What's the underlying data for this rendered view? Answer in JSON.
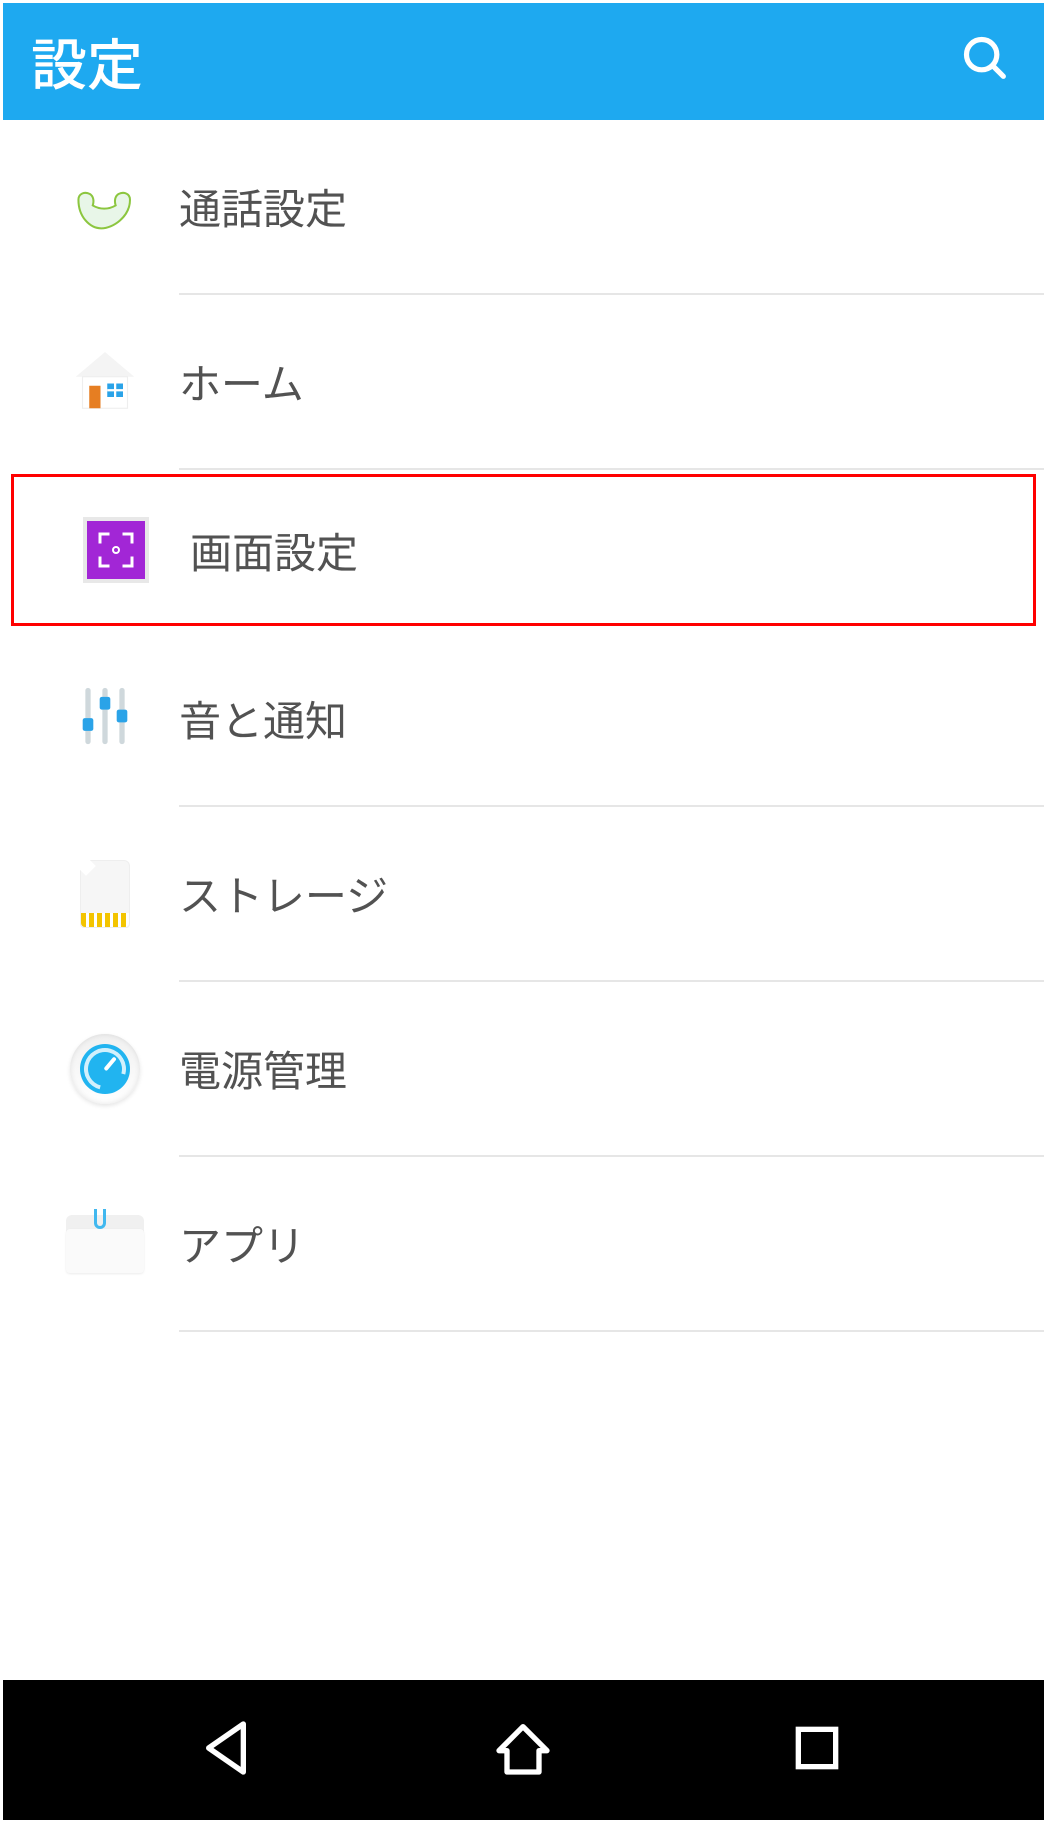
{
  "appbar": {
    "title": "設定",
    "search_icon": "search-icon"
  },
  "settings": {
    "items": [
      {
        "id": "call-settings",
        "label": "通話設定",
        "icon": "phone-icon",
        "highlighted": false
      },
      {
        "id": "home",
        "label": "ホーム",
        "icon": "home-icon",
        "highlighted": false
      },
      {
        "id": "display-settings",
        "label": "画面設定",
        "icon": "display-icon",
        "highlighted": true
      },
      {
        "id": "sound-notif",
        "label": "音と通知",
        "icon": "sliders-icon",
        "highlighted": false
      },
      {
        "id": "storage",
        "label": "ストレージ",
        "icon": "sdcard-icon",
        "highlighted": false
      },
      {
        "id": "power",
        "label": "電源管理",
        "icon": "gauge-icon",
        "highlighted": false
      },
      {
        "id": "apps",
        "label": "アプリ",
        "icon": "folder-icon",
        "highlighted": false
      }
    ]
  },
  "navbar": {
    "back": "back-icon",
    "home": "home-nav-icon",
    "recent": "recent-icon"
  },
  "colors": {
    "accent": "#1ea9f0",
    "highlight_border": "#ff0000",
    "text": "#525252",
    "display_icon_bg": "#a226d6"
  }
}
